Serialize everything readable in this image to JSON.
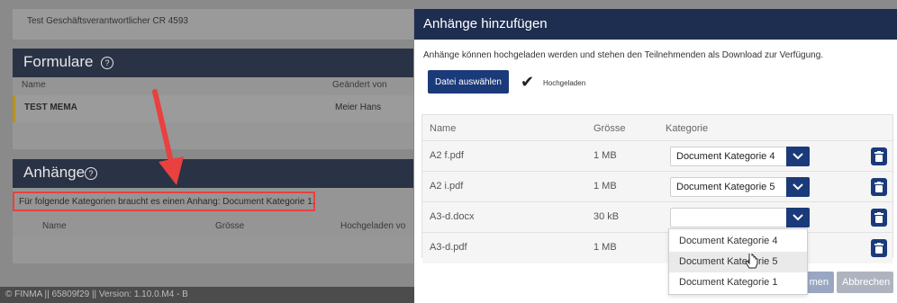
{
  "background": {
    "responsible_text": "Test Geschäftsverantwortlicher CR 4593",
    "formulare": {
      "title": "Formulare",
      "help_icon": "question-circle-icon",
      "columns": [
        "Name",
        "Geändert von"
      ],
      "row": {
        "name": "TEST MEMA",
        "changed_by": "Meier Hans"
      }
    },
    "anhaenge": {
      "title": "Anhänge",
      "help_icon": "question-circle-icon",
      "hint": "Für folgende Kategorien braucht es einen Anhang: Document Kategorie 1.",
      "columns": [
        "Name",
        "Grösse",
        "Hochgeladen vo"
      ]
    },
    "footer": "© FINMA || 65809f29 || Version: 1.10.0.M4 - B"
  },
  "modal": {
    "title": "Anhänge hinzufügen",
    "description": "Anhänge können hochgeladen werden und stehen den Teilnehmenden als Download zur Verfügung.",
    "file_button": "Datei auswählen",
    "uploaded_label": "Hochgeladen",
    "table": {
      "headers": {
        "name": "Name",
        "size": "Grösse",
        "category": "Kategorie"
      },
      "rows": [
        {
          "name": "A2 f.pdf",
          "size": "1 MB",
          "category": "Document Kategorie 4"
        },
        {
          "name": "A2 i.pdf",
          "size": "1 MB",
          "category": "Document Kategorie 5"
        },
        {
          "name": "A3-d.docx",
          "size": "30 kB",
          "category": ""
        },
        {
          "name": "A3-d.pdf",
          "size": "1 MB",
          "category": ""
        }
      ]
    },
    "dropdown_options": [
      "Document Kategorie 4",
      "Document Kategorie 5",
      "Document Kategorie 1"
    ],
    "confirm_button": "men",
    "cancel_button": "Abbrechen"
  },
  "colors": {
    "primary": "#1a3a7a",
    "header": "#1e2e50",
    "annotation": "#e94040"
  }
}
